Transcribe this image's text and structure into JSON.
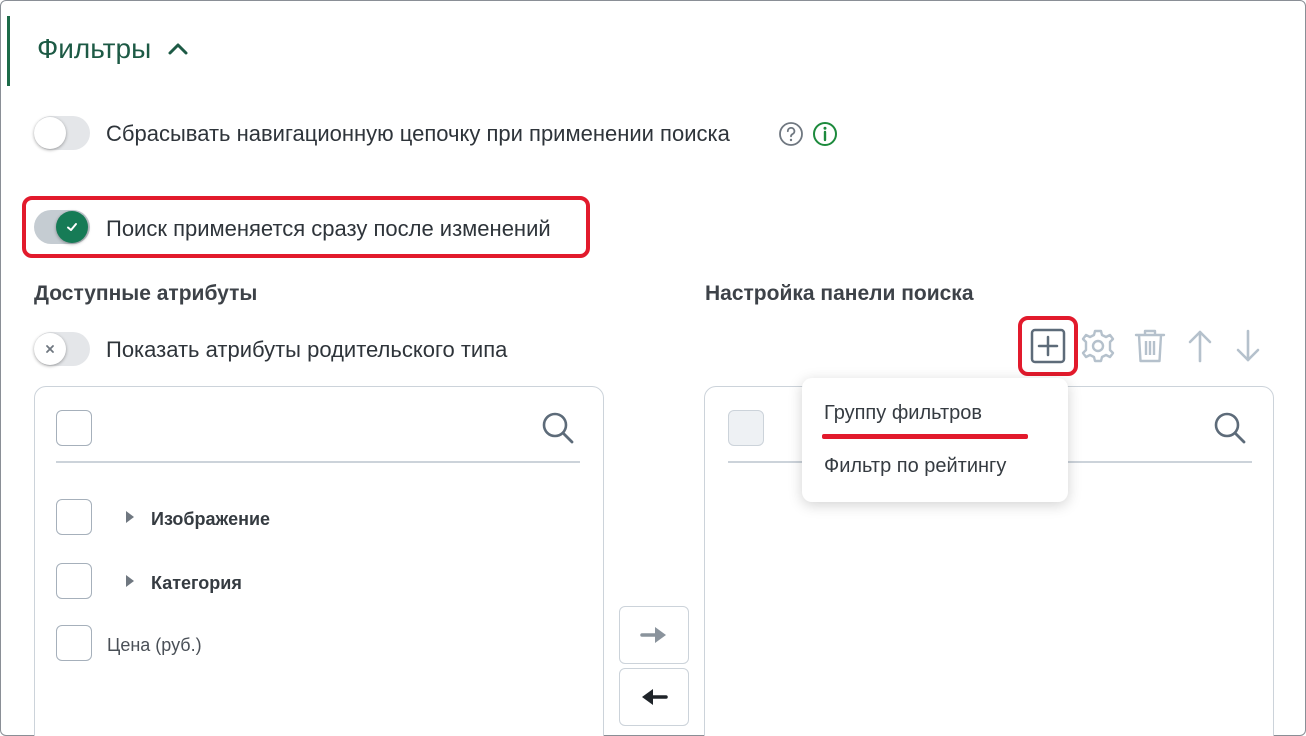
{
  "section": {
    "title": "Фильтры"
  },
  "options": {
    "reset_breadcrumb_label": "Сбрасывать навигационную цепочку при применении поиска",
    "reset_breadcrumb_on": false,
    "instant_search_label": "Поиск применяется сразу после изменений",
    "instant_search_on": true
  },
  "available": {
    "heading": "Доступные атрибуты",
    "show_parent_label": "Показать атрибуты родительского типа",
    "show_parent_on": false,
    "items": [
      {
        "label": "Изображение",
        "expandable": true
      },
      {
        "label": "Категория",
        "expandable": true
      },
      {
        "label": "Цена (руб.)",
        "expandable": false
      }
    ]
  },
  "search_panel": {
    "heading": "Настройка панели поиска",
    "toolbar": [
      "add-icon",
      "settings-icon",
      "trash-icon",
      "arrow-up-icon",
      "arrow-down-icon"
    ],
    "add_menu": [
      {
        "label": "Группу фильтров"
      },
      {
        "label": "Фильтр по рейтингу"
      }
    ]
  },
  "colors": {
    "accent_green": "#167b56",
    "highlight_red": "#e21a2c",
    "title_green": "#1d5a45"
  }
}
